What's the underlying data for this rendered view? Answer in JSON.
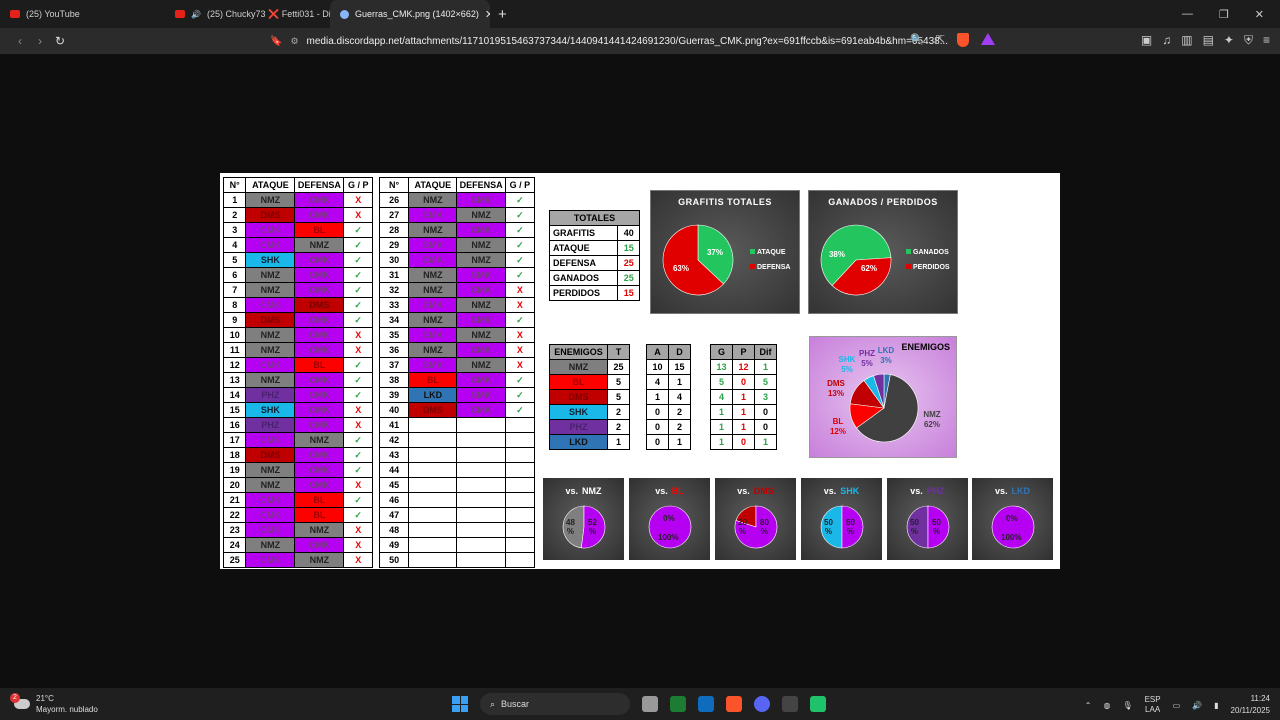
{
  "browser": {
    "tabs": [
      {
        "label": "(25) YouTube",
        "icon": "youtube-icon"
      },
      {
        "label": "(25) Chucky73 ❌ Fetti031 - Dil",
        "icon": "youtube-icon"
      },
      {
        "label": "Guerras_CMK.png (1402×662)",
        "icon": "image-icon",
        "active": true
      }
    ],
    "url": "media.discordapp.net/attachments/1171019515463737344/1440941441424691230/Guerras_CMK.png?ex=691ffccb&is=691eab4b&hm=65438...",
    "brave_badge": "1"
  },
  "sheet": {
    "headers": {
      "n": "N°",
      "attack": "ATAQUE",
      "defense": "DEFENSA",
      "gp": "G / P"
    },
    "rows_left": [
      {
        "n": "1",
        "a": "NMZ",
        "d": "CMK",
        "r": "X"
      },
      {
        "n": "2",
        "a": "DMS",
        "d": "CMK",
        "r": "X"
      },
      {
        "n": "3",
        "a": "CMK",
        "d": "BL",
        "r": "✓"
      },
      {
        "n": "4",
        "a": "CMK",
        "d": "NMZ",
        "r": "✓"
      },
      {
        "n": "5",
        "a": "SHK",
        "d": "CMK",
        "r": "✓"
      },
      {
        "n": "6",
        "a": "NMZ",
        "d": "CMK",
        "r": "✓"
      },
      {
        "n": "7",
        "a": "NMZ",
        "d": "CMK",
        "r": "✓"
      },
      {
        "n": "8",
        "a": "CMK",
        "d": "DMS",
        "r": "✓"
      },
      {
        "n": "9",
        "a": "DMS",
        "d": "CMK",
        "r": "✓"
      },
      {
        "n": "10",
        "a": "NMZ",
        "d": "CMK",
        "r": "X"
      },
      {
        "n": "11",
        "a": "NMZ",
        "d": "CMK",
        "r": "X"
      },
      {
        "n": "12",
        "a": "CMK",
        "d": "BL",
        "r": "✓"
      },
      {
        "n": "13",
        "a": "NMZ",
        "d": "CMK",
        "r": "✓"
      },
      {
        "n": "14",
        "a": "PHZ",
        "d": "CMK",
        "r": "✓"
      },
      {
        "n": "15",
        "a": "SHK",
        "d": "CMK",
        "r": "X"
      },
      {
        "n": "16",
        "a": "PHZ",
        "d": "CMK",
        "r": "X"
      },
      {
        "n": "17",
        "a": "CMK",
        "d": "NMZ",
        "r": "✓"
      },
      {
        "n": "18",
        "a": "DMS",
        "d": "CMK",
        "r": "✓"
      },
      {
        "n": "19",
        "a": "NMZ",
        "d": "CMK",
        "r": "✓"
      },
      {
        "n": "20",
        "a": "NMZ",
        "d": "CMK",
        "r": "X"
      },
      {
        "n": "21",
        "a": "CMK",
        "d": "BL",
        "r": "✓"
      },
      {
        "n": "22",
        "a": "CMK",
        "d": "BL",
        "r": "✓"
      },
      {
        "n": "23",
        "a": "CMK",
        "d": "NMZ",
        "r": "X"
      },
      {
        "n": "24",
        "a": "NMZ",
        "d": "CMK",
        "r": "X"
      },
      {
        "n": "25",
        "a": "CMK",
        "d": "NMZ",
        "r": "X"
      }
    ],
    "rows_right": [
      {
        "n": "26",
        "a": "NMZ",
        "d": "CMK",
        "r": "✓"
      },
      {
        "n": "27",
        "a": "CMK",
        "d": "NMZ",
        "r": "✓"
      },
      {
        "n": "28",
        "a": "NMZ",
        "d": "CMK",
        "r": "✓"
      },
      {
        "n": "29",
        "a": "CMK",
        "d": "NMZ",
        "r": "✓"
      },
      {
        "n": "30",
        "a": "CMK",
        "d": "NMZ",
        "r": "✓"
      },
      {
        "n": "31",
        "a": "NMZ",
        "d": "CMK",
        "r": "✓"
      },
      {
        "n": "32",
        "a": "NMZ",
        "d": "CMK",
        "r": "X"
      },
      {
        "n": "33",
        "a": "CMK",
        "d": "NMZ",
        "r": "X"
      },
      {
        "n": "34",
        "a": "NMZ",
        "d": "CMK",
        "r": "✓"
      },
      {
        "n": "35",
        "a": "CMK",
        "d": "NMZ",
        "r": "X"
      },
      {
        "n": "36",
        "a": "NMZ",
        "d": "CMK",
        "r": "X"
      },
      {
        "n": "37",
        "a": "CMK",
        "d": "NMZ",
        "r": "X"
      },
      {
        "n": "38",
        "a": "BL",
        "d": "CMK",
        "r": "✓"
      },
      {
        "n": "39",
        "a": "LKD",
        "d": "CMK",
        "r": "✓"
      },
      {
        "n": "40",
        "a": "DMS",
        "d": "CMK",
        "r": "✓"
      },
      {
        "n": "41",
        "a": "",
        "d": "",
        "r": ""
      },
      {
        "n": "42",
        "a": "",
        "d": "",
        "r": ""
      },
      {
        "n": "43",
        "a": "",
        "d": "",
        "r": ""
      },
      {
        "n": "44",
        "a": "",
        "d": "",
        "r": ""
      },
      {
        "n": "45",
        "a": "",
        "d": "",
        "r": ""
      },
      {
        "n": "46",
        "a": "",
        "d": "",
        "r": ""
      },
      {
        "n": "47",
        "a": "",
        "d": "",
        "r": ""
      },
      {
        "n": "48",
        "a": "",
        "d": "",
        "r": ""
      },
      {
        "n": "49",
        "a": "",
        "d": "",
        "r": ""
      },
      {
        "n": "50",
        "a": "",
        "d": "",
        "r": ""
      }
    ],
    "totales": {
      "title": "TOTALES",
      "rows": [
        {
          "label": "GRAFITIS",
          "value": "40",
          "color": "#000000"
        },
        {
          "label": "ATAQUE",
          "value": "15",
          "color": "#2ca34a"
        },
        {
          "label": "DEFENSA",
          "value": "25",
          "color": "#e00000"
        },
        {
          "label": "GANADOS",
          "value": "25",
          "color": "#2ca34a"
        },
        {
          "label": "PERDIDOS",
          "value": "15",
          "color": "#e00000"
        }
      ]
    },
    "enemigos_table": {
      "headers": [
        "ENEMIGOS",
        "T",
        "A",
        "D",
        "G",
        "P",
        "Dif"
      ],
      "rows": [
        {
          "name": "NMZ",
          "t": "25",
          "a": "10",
          "d": "15",
          "g": "13",
          "p": "12",
          "dif": "1"
        },
        {
          "name": "BL",
          "t": "5",
          "a": "4",
          "d": "1",
          "g": "5",
          "p": "0",
          "dif": "5"
        },
        {
          "name": "DMS",
          "t": "5",
          "a": "1",
          "d": "4",
          "g": "4",
          "p": "1",
          "dif": "3"
        },
        {
          "name": "SHK",
          "t": "2",
          "a": "0",
          "d": "2",
          "g": "1",
          "p": "1",
          "dif": "0"
        },
        {
          "name": "PHZ",
          "t": "2",
          "a": "0",
          "d": "2",
          "g": "1",
          "p": "1",
          "dif": "0"
        },
        {
          "name": "LKD",
          "t": "1",
          "a": "0",
          "d": "1",
          "g": "1",
          "p": "0",
          "dif": "1"
        }
      ]
    },
    "team_colors": {
      "NMZ": "#7f7f7f",
      "CMK": "#b600f2",
      "BL": "#ff0000",
      "DMS": "#c00000",
      "SHK": "#19b8e8",
      "PHZ": "#7030a0",
      "LKD": "#2f75b5"
    },
    "vs_charts": [
      {
        "title_prefix": "vs.",
        "team": "NMZ",
        "team_color": "#ffffff",
        "left_label": "48\n%",
        "right_label": "52\n%",
        "left_pct": 48,
        "left_color": "#7f7f7f"
      },
      {
        "title_prefix": "vs.",
        "team": "BL",
        "team_color": "#ff0000",
        "left_label": "0%",
        "right_label": "100%",
        "left_pct": 0,
        "left_color": "#ff0000"
      },
      {
        "title_prefix": "vs.",
        "team": "DMS",
        "team_color": "#c00000",
        "left_label": "20\n%",
        "right_label": "80\n%",
        "left_pct": 20,
        "left_color": "#c00000"
      },
      {
        "title_prefix": "vs.",
        "team": "SHK",
        "team_color": "#19b8e8",
        "left_label": "50\n%",
        "right_label": "50\n%",
        "left_pct": 50,
        "left_color": "#19b8e8"
      },
      {
        "title_prefix": "vs.",
        "team": "PHZ",
        "team_color": "#7030a0",
        "left_label": "50\n%",
        "right_label": "50\n%",
        "left_pct": 50,
        "left_color": "#7030a0"
      },
      {
        "title_prefix": "vs.",
        "team": "LKD",
        "team_color": "#2f75b5",
        "left_label": "0%",
        "right_label": "100%",
        "left_pct": 0,
        "left_color": "#2f75b5"
      }
    ]
  },
  "chart_data": [
    {
      "type": "pie",
      "title": "GRAFITIS TOTALES",
      "categories": [
        "ATAQUE",
        "DEFENSA"
      ],
      "values": [
        37,
        63
      ],
      "colors": [
        "#22c55e",
        "#e00000"
      ],
      "labels": [
        "37%",
        "63%"
      ],
      "legend": "right"
    },
    {
      "type": "pie",
      "title": "GANADOS / PERDIDOS",
      "categories": [
        "GANADOS",
        "PERDIDOS"
      ],
      "values": [
        62,
        38
      ],
      "colors": [
        "#22c55e",
        "#e00000"
      ],
      "labels": [
        "62%",
        "38%"
      ],
      "legend": "right"
    },
    {
      "type": "pie",
      "title": "ENEMIGOS",
      "categories": [
        "NMZ",
        "BL",
        "DMS",
        "SHK",
        "PHZ",
        "LKD"
      ],
      "values": [
        62,
        12,
        13,
        5,
        5,
        3
      ],
      "colors": [
        "#404040",
        "#ff0000",
        "#c00000",
        "#19b8e8",
        "#7030a0",
        "#2f75b5"
      ],
      "labels": [
        "62%",
        "12%",
        "13%",
        "5%",
        "5%",
        "3%"
      ]
    }
  ],
  "taskbar": {
    "weather_temp": "21°C",
    "weather_desc": "Mayorm. nublado",
    "weather_badge": "2",
    "search_label": "Buscar",
    "lang_top": "ESP",
    "lang_bottom": "LAA",
    "time": "11:24",
    "date": "20/11/2025"
  }
}
